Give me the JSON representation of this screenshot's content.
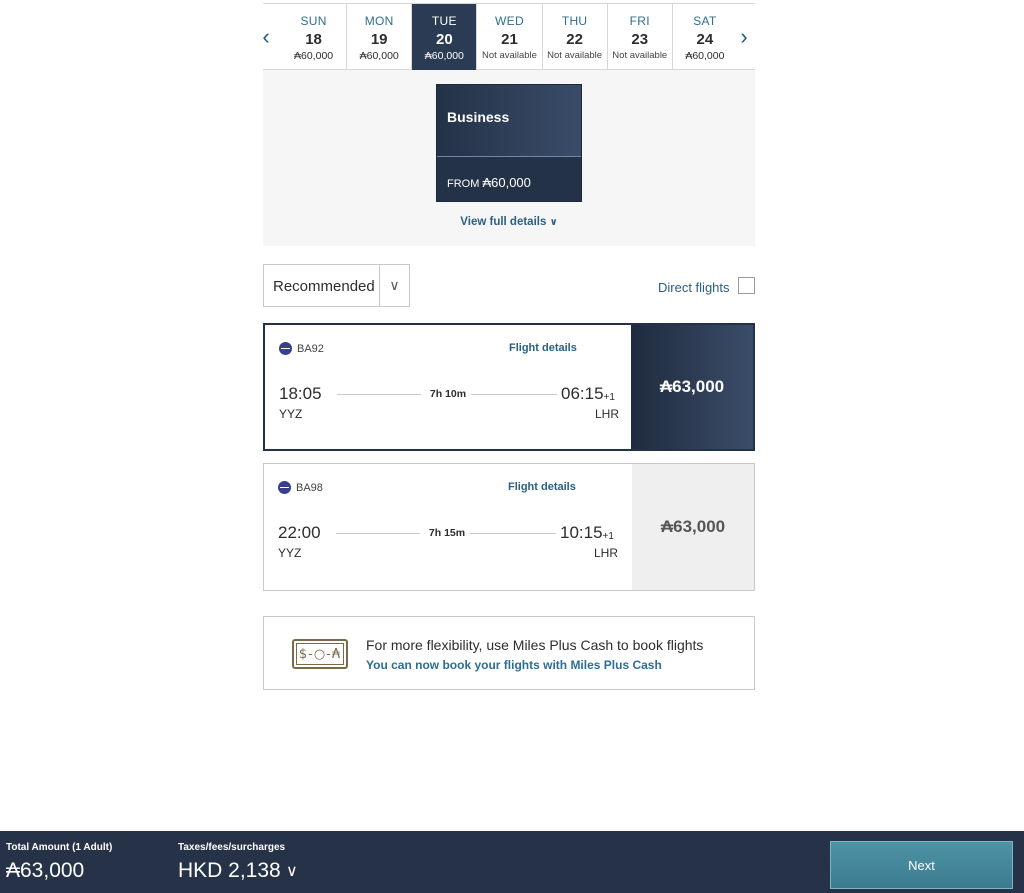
{
  "date_strip": {
    "prev_icon": "chevron-left-icon",
    "next_icon": "chevron-right-icon",
    "days": [
      {
        "dow": "SUN",
        "date": "18",
        "price": "₳60,000",
        "available": true,
        "selected": false
      },
      {
        "dow": "MON",
        "date": "19",
        "price": "₳60,000",
        "available": true,
        "selected": false
      },
      {
        "dow": "TUE",
        "date": "20",
        "price": "₳60,000",
        "available": true,
        "selected": true
      },
      {
        "dow": "WED",
        "date": "21",
        "price": "Not available",
        "available": false,
        "selected": false
      },
      {
        "dow": "THU",
        "date": "22",
        "price": "Not available",
        "available": false,
        "selected": false
      },
      {
        "dow": "FRI",
        "date": "23",
        "price": "Not available",
        "available": false,
        "selected": false
      },
      {
        "dow": "SAT",
        "date": "24",
        "price": "₳60,000",
        "available": true,
        "selected": false
      }
    ]
  },
  "cabin": {
    "name": "Business",
    "from_label": "FROM",
    "from_price": "₳60,000",
    "view_details": "View full details"
  },
  "sort": {
    "selected": "Recommended"
  },
  "filter": {
    "direct_label": "Direct flights",
    "direct_checked": false
  },
  "flights": [
    {
      "flight_no": "BA92",
      "details_link": "Flight details",
      "dep_time": "18:05",
      "dep_code": "YYZ",
      "duration": "7h 10m",
      "arr_time": "06:15",
      "arr_offset": "+1",
      "arr_code": "LHR",
      "price": "₳63,000",
      "selected": true
    },
    {
      "flight_no": "BA98",
      "details_link": "Flight details",
      "dep_time": "22:00",
      "dep_code": "YYZ",
      "duration": "7h 15m",
      "arr_time": "10:15",
      "arr_offset": "+1",
      "arr_code": "LHR",
      "price": "₳63,000",
      "selected": false
    }
  ],
  "promo": {
    "icon": "money-plus-miles-icon",
    "icon_text": "$-○-₳",
    "line1": "For more flexibility, use Miles Plus Cash to book flights",
    "line2": "You can now book your flights with Miles Plus Cash"
  },
  "footer": {
    "total_label": "Total Amount (1 Adult)",
    "total_value": "₳63,000",
    "taxes_label": "Taxes/fees/surcharges",
    "taxes_value": "HKD 2,138",
    "next_label": "Next"
  },
  "colors": {
    "navy": "#243248",
    "link": "#2a5f80",
    "next_button": "#4a8ea1"
  }
}
